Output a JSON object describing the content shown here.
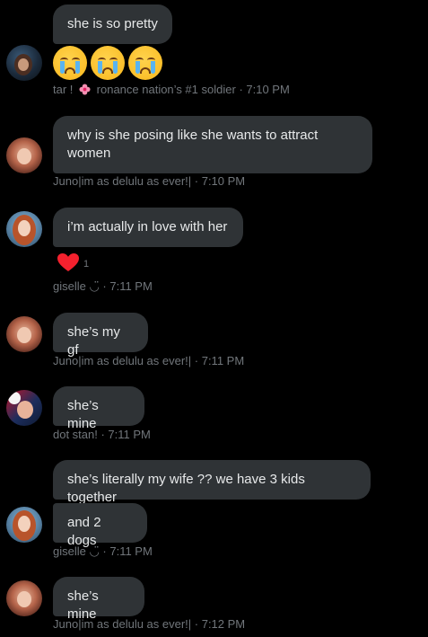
{
  "messages": [
    {
      "text": "she is so pretty"
    },
    {
      "text": "why is she posing like she wants to attract women"
    },
    {
      "text": "i’m actually in love with her"
    },
    {
      "text": "she’s my gf"
    },
    {
      "text": "she’s mine"
    },
    {
      "text": "she’s literally my wife ?? we have 3 kids together"
    },
    {
      "text": "and 2 dogs"
    },
    {
      "text": "she’s mine"
    }
  ],
  "meta": {
    "m1_name_a": "tar !",
    "m1_name_b": "ronance nation’s #1 soldier",
    "m1_time": "· 7:10 PM",
    "m2": "Juno|im as delulu as ever!| · 7:10 PM",
    "m3": "giselle ◡̈ · 7:11 PM",
    "m4": "Juno|im as delulu as ever!| · 7:11 PM",
    "m5": "dot stan! · 7:11 PM",
    "m6": "giselle ◡̈ · 7:11 PM",
    "m7": "Juno|im as delulu as ever!| · 7:12 PM"
  },
  "reaction": {
    "icon": "heart-icon",
    "count": "1",
    "color": "#f91880"
  },
  "emoji": [
    "crying-face",
    "crying-face",
    "crying-face"
  ],
  "colors": {
    "background": "#000000",
    "bubble": "#2f3336",
    "meta": "#71767b",
    "text": "#e7e9ea"
  }
}
